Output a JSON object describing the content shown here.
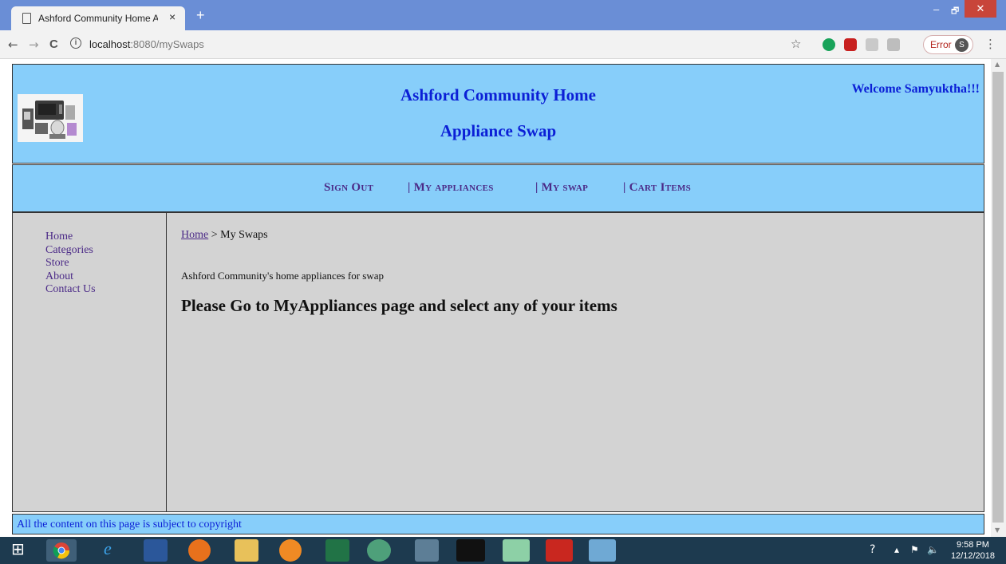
{
  "browser": {
    "tab_title": "Ashford Community Home Appli",
    "tab_close": "×",
    "new_tab": "+",
    "url_host": "localhost",
    "url_path": ":8080/mySwaps",
    "error_label": "Error",
    "profile_initial": "S",
    "back": "←",
    "forward": "→",
    "reload": "C",
    "info": "i",
    "star": "☆",
    "menu": "⋮",
    "minimize": "–",
    "restore": "🗗",
    "close": "✕"
  },
  "header": {
    "title_line1": "Ashford Community Home",
    "title_line2": "Appliance Swap",
    "welcome": "Welcome Samyuktha!!!"
  },
  "nav": {
    "sign_out": "Sign Out",
    "my_appliances": "| My appliances",
    "my_swap": "| My swap",
    "cart_items": "| Cart Items"
  },
  "sidebar": {
    "items": [
      "Home",
      "Categories",
      "Store",
      "About",
      "Contact Us"
    ]
  },
  "main": {
    "breadcrumb_home": "Home",
    "breadcrumb_rest": " > My Swaps",
    "description": "Ashford Community's home appliances for swap",
    "notice": "Please Go to MyAppliances page and select any of your items"
  },
  "footer": {
    "text": "All the content on this page is subject to copyright"
  },
  "taskbar": {
    "time": "9:58 PM",
    "date": "12/12/2018"
  },
  "colors": {
    "header_bg": "#87cefa",
    "content_bg": "#d3d3d3",
    "title_blue": "#0b1fd6",
    "link_purple": "#4b2a87",
    "chrome_frame": "#6a8ed6"
  }
}
